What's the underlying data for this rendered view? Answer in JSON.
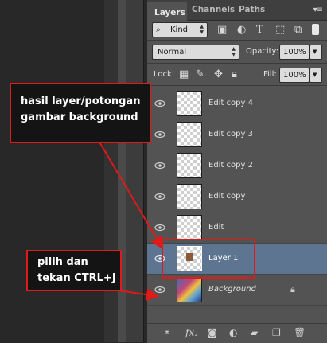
{
  "tabs": [
    {
      "label": "Layers"
    },
    {
      "label": "Channels"
    },
    {
      "label": "Paths"
    }
  ],
  "filter": {
    "kind_label": "Kind"
  },
  "blend": {
    "mode": "Normal",
    "opacity_label": "Opacity:",
    "opacity_value": "100%"
  },
  "lock": {
    "label": "Lock:",
    "fill_label": "Fill:",
    "fill_value": "100%"
  },
  "layers": [
    {
      "name": "Edit copy 4"
    },
    {
      "name": "Edit copy 3"
    },
    {
      "name": "Edit copy 2"
    },
    {
      "name": "Edit copy"
    },
    {
      "name": "Edit"
    },
    {
      "name": "Layer 1"
    },
    {
      "name": "Background"
    }
  ],
  "bottom_bar": {
    "fx_label": "fx."
  },
  "annotations": {
    "callout_top": "hasil layer/potongan gambar background",
    "callout_bottom": "pilih dan tekan CTRL+J"
  },
  "colors": {
    "annotation_red": "#e01919",
    "selected_row": "#5d7591",
    "panel_bg": "#535353"
  }
}
